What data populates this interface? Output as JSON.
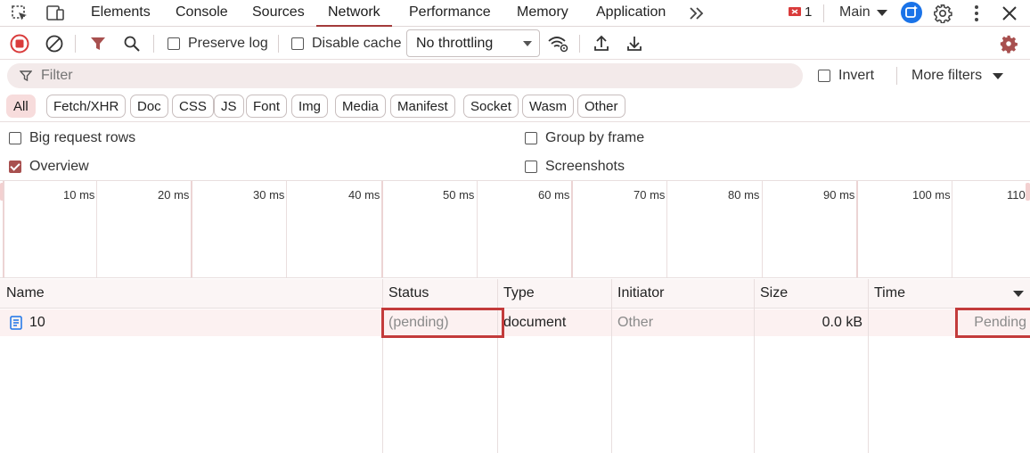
{
  "tabs": {
    "elements": "Elements",
    "console": "Console",
    "sources": "Sources",
    "network": "Network",
    "performance": "Performance",
    "memory": "Memory",
    "application": "Application"
  },
  "topbar": {
    "issues_count": "1",
    "context": "Main"
  },
  "toolbar": {
    "preserve_log": "Preserve log",
    "disable_cache": "Disable cache",
    "throttling": "No throttling"
  },
  "filter": {
    "placeholder": "Filter",
    "invert": "Invert",
    "more_filters": "More filters"
  },
  "chips": [
    "All",
    "Fetch/XHR",
    "Doc",
    "CSS",
    "JS",
    "Font",
    "Img",
    "Media",
    "Manifest",
    "Socket",
    "Wasm",
    "Other"
  ],
  "options": {
    "big_request_rows": "Big request rows",
    "group_by_frame": "Group by frame",
    "overview": "Overview",
    "screenshots": "Screenshots"
  },
  "overview_ticks": [
    "10 ms",
    "20 ms",
    "30 ms",
    "40 ms",
    "50 ms",
    "60 ms",
    "70 ms",
    "80 ms",
    "90 ms",
    "100 ms",
    "110"
  ],
  "table": {
    "headers": [
      "Name",
      "Status",
      "Type",
      "Initiator",
      "Size",
      "Time"
    ],
    "rows": [
      {
        "name": "10",
        "status": "(pending)",
        "type": "document",
        "initiator": "Other",
        "size": "0.0 kB",
        "time": "Pending"
      }
    ]
  },
  "colors": {
    "accent": "#a33b3b",
    "highlight": "#c33b3b",
    "record_red": "#d93b3b",
    "filter_bg": "#f3eaea",
    "chip_active": "#f7dcdc",
    "issue_red": "#d93b3b",
    "context_blue": "#1a73e8",
    "settings_brown": "#a8504f"
  }
}
